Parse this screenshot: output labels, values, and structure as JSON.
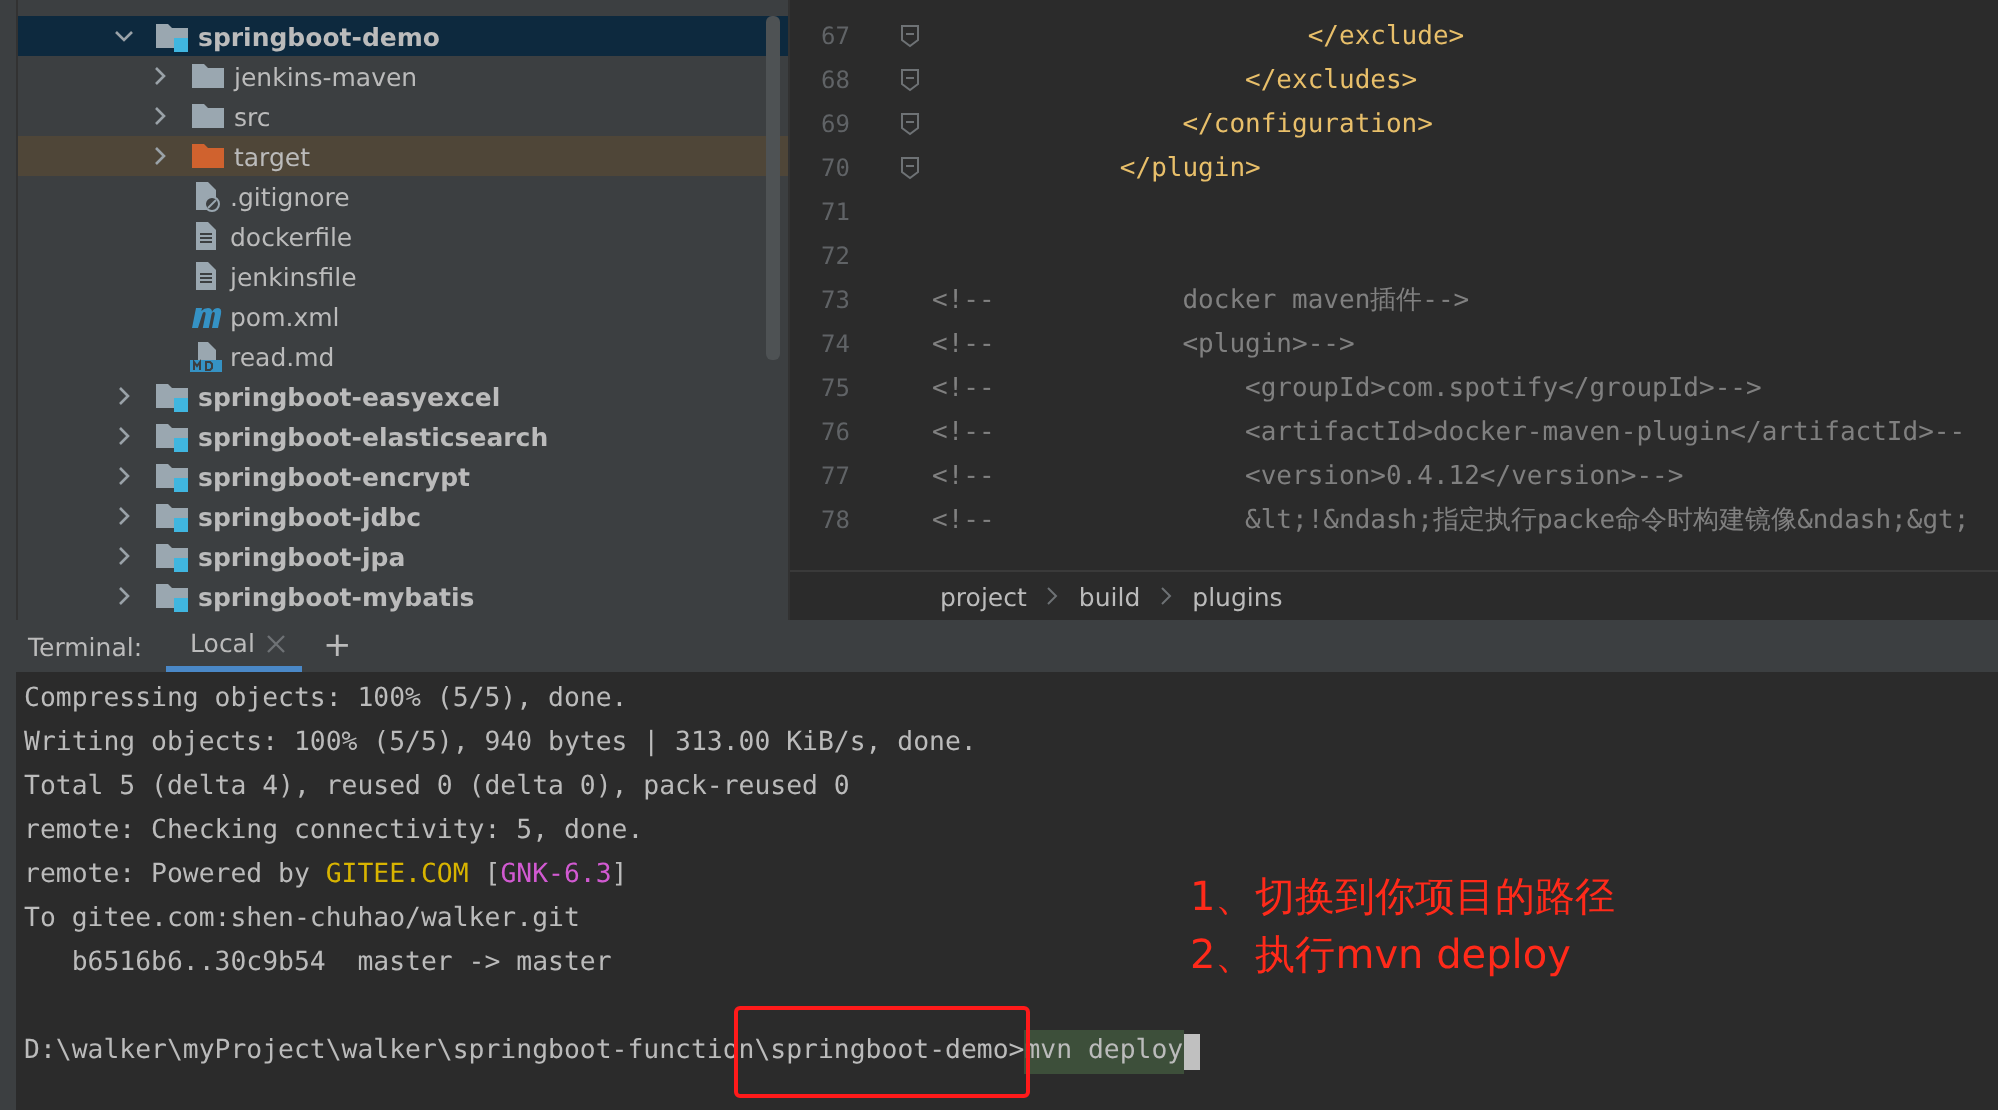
{
  "project_tree": {
    "items": [
      {
        "label": "springboot-demo",
        "kind": "module",
        "expanded": true,
        "selected": true,
        "children": [
          {
            "label": "jenkins-maven",
            "kind": "folder",
            "expanded": false,
            "selected": false
          },
          {
            "label": "src",
            "kind": "folder",
            "expanded": false,
            "selected": false
          },
          {
            "label": "target",
            "kind": "excluded-folder",
            "expanded": false,
            "selected": false
          },
          {
            "label": ".gitignore",
            "kind": "ignore-file",
            "selected": false
          },
          {
            "label": "dockerfile",
            "kind": "file",
            "selected": false
          },
          {
            "label": "jenkinsfile",
            "kind": "file",
            "selected": false
          },
          {
            "label": "pom.xml",
            "kind": "maven",
            "selected": false
          },
          {
            "label": "read.md",
            "kind": "markdown",
            "selected": false
          }
        ]
      },
      {
        "label": "springboot-easyexcel",
        "kind": "module",
        "expanded": false,
        "selected": false
      },
      {
        "label": "springboot-elasticsearch",
        "kind": "module",
        "expanded": false,
        "selected": false
      },
      {
        "label": "springboot-encrypt",
        "kind": "module",
        "expanded": false,
        "selected": false
      },
      {
        "label": "springboot-jdbc",
        "kind": "module",
        "expanded": false,
        "selected": false
      },
      {
        "label": "springboot-jpa",
        "kind": "module",
        "expanded": false,
        "selected": false
      },
      {
        "label": "springboot-mybatis",
        "kind": "module",
        "expanded": false,
        "selected": false
      }
    ]
  },
  "editor": {
    "lines": [
      {
        "number": "67",
        "kind": "tag",
        "fold": true,
        "text": "                        </exclude>"
      },
      {
        "number": "68",
        "kind": "tag",
        "fold": true,
        "text": "                    </excludes>"
      },
      {
        "number": "69",
        "kind": "tag",
        "fold": true,
        "text": "                </configuration>"
      },
      {
        "number": "70",
        "kind": "tag",
        "fold": true,
        "text": "            </plugin>"
      },
      {
        "number": "71",
        "kind": "blank"
      },
      {
        "number": "72",
        "kind": "blank"
      },
      {
        "number": "73",
        "kind": "comment",
        "marker": "<!--",
        "text": "            docker maven插件-->"
      },
      {
        "number": "74",
        "kind": "comment",
        "marker": "<!--",
        "text": "            <plugin>-->"
      },
      {
        "number": "75",
        "kind": "comment",
        "marker": "<!--",
        "text": "                <groupId>com.spotify</groupId>-->"
      },
      {
        "number": "76",
        "kind": "comment",
        "marker": "<!--",
        "text": "                <artifactId>docker-maven-plugin</artifactId>--"
      },
      {
        "number": "77",
        "kind": "comment",
        "marker": "<!--",
        "text": "                <version>0.4.12</version>-->"
      },
      {
        "number": "78",
        "kind": "comment",
        "marker": "<!--",
        "text": "                &lt;!&ndash;指定执行packe命令时构建镜像&ndash;&gt;"
      }
    ],
    "breadcrumbs": [
      "project",
      "build",
      "plugins"
    ]
  },
  "terminal": {
    "label": "Terminal:",
    "tabs": [
      {
        "label": "Local",
        "selected": true
      }
    ],
    "add_button": "+",
    "lines": [
      [
        {
          "text": "Compressing objects: 100% (5/5), done.",
          "kind": "plain"
        }
      ],
      [
        {
          "text": "Writing objects: 100% (5/5), 940 bytes | 313.00 KiB/s, done.",
          "kind": "plain"
        }
      ],
      [
        {
          "text": "Total 5 (delta 4), reused 0 (delta 0), pack-reused 0",
          "kind": "plain"
        }
      ],
      [
        {
          "text": "remote: Checking connectivity: 5, done.",
          "kind": "plain"
        }
      ],
      [
        {
          "text": "remote: Powered by ",
          "kind": "plain"
        },
        {
          "text": "GITEE.COM",
          "kind": "yellow"
        },
        {
          "text": " [",
          "kind": "plain"
        },
        {
          "text": "GNK-6.3",
          "kind": "magenta"
        },
        {
          "text": "]",
          "kind": "plain"
        }
      ],
      [
        {
          "text": "To gitee.com:shen-chuhao/walker.git",
          "kind": "plain"
        }
      ],
      [
        {
          "text": "   b6516b6..30c9b54  master -> master",
          "kind": "plain"
        }
      ]
    ],
    "prompt_path": "D:\\walker\\myProject\\walker\\springboot-function",
    "prompt_dir": "\\springboot-demo>",
    "command": "mvn deploy"
  },
  "annotation": {
    "lines": [
      "1、切换到你项目的路径",
      "2、执行mvn deploy"
    ]
  }
}
